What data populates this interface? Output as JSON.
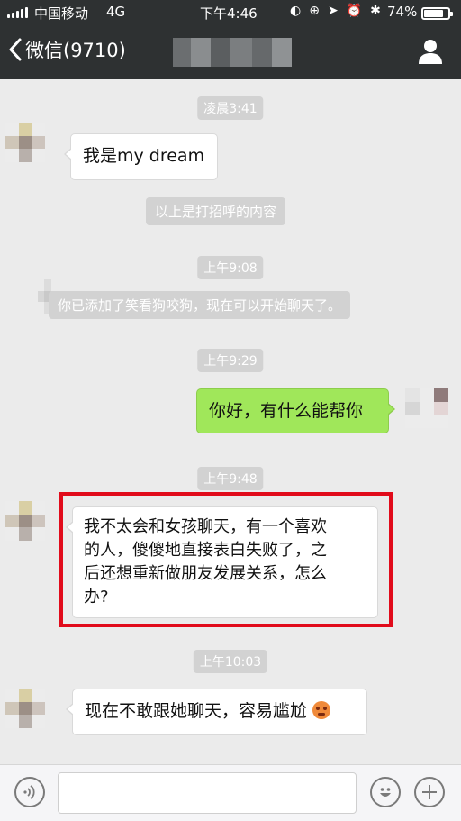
{
  "status_bar": {
    "carrier": "中国移动",
    "network": "4G",
    "time": "下午4:46",
    "battery": "74%"
  },
  "nav": {
    "back_label": "微信(9710)"
  },
  "chat": {
    "timestamps": [
      "凌晨3:41",
      "上午9:08",
      "上午9:29",
      "上午9:48",
      "上午10:03"
    ],
    "system_messages": [
      "以上是打招呼的内容",
      "你已添加了笑看狗咬狗，现在可以开始聊天了。"
    ],
    "messages": [
      {
        "direction": "in",
        "lines": [
          "我是my dream"
        ]
      },
      {
        "direction": "out",
        "lines": [
          "你好，有什么能帮你"
        ]
      },
      {
        "direction": "in",
        "lines": [
          "我不太会和女孩聊天，有一个喜欢",
          "的人，傻傻地直接表白失败了，之",
          "后还想重新做朋友发展关系，怎么",
          "办?"
        ]
      },
      {
        "direction": "in",
        "lines": [
          "现在不敢跟她聊天，容易尴尬"
        ],
        "trailing_icon": "flushed-face-emoji"
      }
    ]
  },
  "colors": {
    "nav_background": "#2e3132",
    "chat_background": "#ebebeb",
    "outgoing_bubble": "#a0e75a",
    "highlight_border": "#e10b1b"
  },
  "icons": [
    "back-chevron-icon",
    "profile-icon",
    "voice-icon",
    "emoji-icon",
    "plus-icon"
  ]
}
